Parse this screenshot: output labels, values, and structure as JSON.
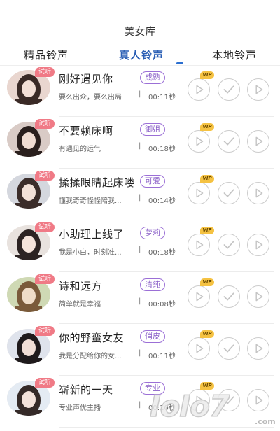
{
  "header": {
    "title": "美女库"
  },
  "tabs": [
    {
      "label": "精品铃声",
      "active": false
    },
    {
      "label": "真人铃声",
      "active": true
    },
    {
      "label": "本地铃声",
      "active": false
    }
  ],
  "badges": {
    "trial": "试听",
    "vip": "VIP"
  },
  "separator": "|",
  "songs": [
    {
      "title": "刚好遇见你",
      "tag": "成熟",
      "desc": "要么出众，要么出局",
      "duration": "00:11秒",
      "trial": true
    },
    {
      "title": "不要赖床啊",
      "tag": "御姐",
      "desc": "有遇见的运气",
      "duration": "00:18秒",
      "trial": true
    },
    {
      "title": "揉揉眼睛起床喽",
      "tag": "可爱",
      "desc": "懂我奇奇怪怪陪我...",
      "duration": "00:14秒",
      "trial": true
    },
    {
      "title": "小助理上线了",
      "tag": "萝莉",
      "desc": "我是小白，时刻准...",
      "duration": "00:18秒",
      "trial": true
    },
    {
      "title": "诗和远方",
      "tag": "清纯",
      "desc": "简单就是幸福",
      "duration": "00:08秒",
      "trial": true
    },
    {
      "title": "你的野蛮女友",
      "tag": "俏皮",
      "desc": "我是分配给你的女...",
      "duration": "00:11秒",
      "trial": true
    },
    {
      "title": "崭新的一天",
      "tag": "专业",
      "desc": "专业声优主播",
      "duration": "00:10秒",
      "trial": true
    }
  ],
  "watermark": {
    "text": "IoIo7",
    "sub": ".com"
  },
  "colors": {
    "accent": "#2b5fb5",
    "tag_purple": "#8a5fc8",
    "trial_pink": "#f07a86",
    "vip_gold": "#f5c242"
  },
  "icons": {
    "play": "play-icon",
    "check": "check-icon"
  }
}
